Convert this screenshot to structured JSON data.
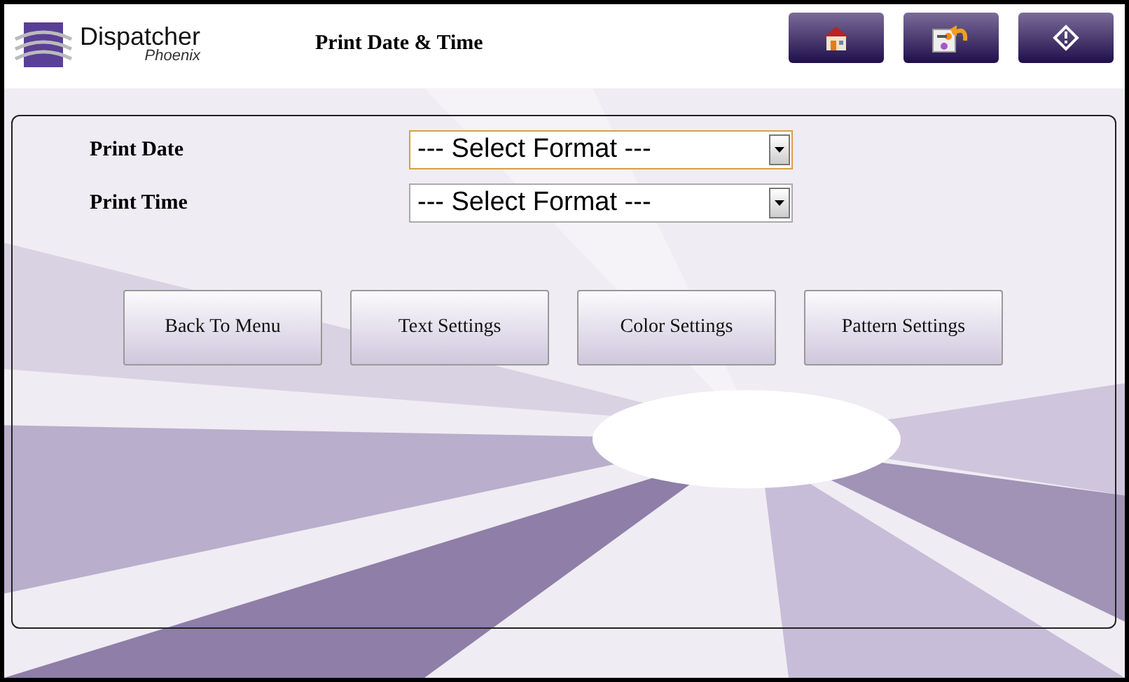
{
  "logo": {
    "name": "Dispatcher",
    "subtitle": "Phoenix"
  },
  "title": "Print Date & Time",
  "header_buttons": [
    {
      "kind": "home"
    },
    {
      "kind": "back"
    },
    {
      "kind": "info"
    }
  ],
  "fields": [
    {
      "label": "Print Date",
      "value": "--- Select Format ---",
      "focused": true
    },
    {
      "label": "Print Time",
      "value": "--- Select Format ---",
      "focused": false
    }
  ],
  "buttons": [
    "Back To Menu",
    "Text Settings",
    "Color Settings",
    "Pattern Settings"
  ]
}
